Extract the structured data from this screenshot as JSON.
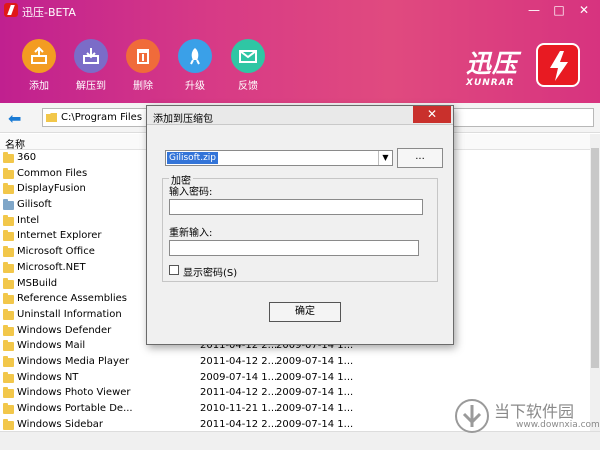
{
  "window": {
    "title": "迅压-BETA",
    "min": "—",
    "max": "□",
    "close": "✕"
  },
  "toolbar": {
    "add": "添加",
    "extract": "解压到",
    "delete": "删除",
    "upgrade": "升级",
    "feedback": "反馈"
  },
  "brand": {
    "cn": "迅压",
    "en": "XUNRAR"
  },
  "address": {
    "path": "C:\\Program Files (x86"
  },
  "list": {
    "header_name": "名称",
    "rows": [
      {
        "name": "360",
        "d1": "",
        "d2": ""
      },
      {
        "name": "Common Files",
        "d1": "",
        "d2": ""
      },
      {
        "name": "DisplayFusion",
        "d1": "",
        "d2": ""
      },
      {
        "name": "Gilisoft",
        "d1": "",
        "d2": ""
      },
      {
        "name": "Intel",
        "d1": "",
        "d2": ""
      },
      {
        "name": "Internet Explorer",
        "d1": "",
        "d2": ""
      },
      {
        "name": "Microsoft Office",
        "d1": "",
        "d2": ""
      },
      {
        "name": "Microsoft.NET",
        "d1": "",
        "d2": ""
      },
      {
        "name": "MSBuild",
        "d1": "",
        "d2": ""
      },
      {
        "name": "Reference Assemblies",
        "d1": "",
        "d2": ""
      },
      {
        "name": "Uninstall Information",
        "d1": "",
        "d2": ""
      },
      {
        "name": "Windows Defender",
        "d1": "",
        "d2": ""
      },
      {
        "name": "Windows Mail",
        "d1": "2011-04-12 2...",
        "d2": "2009-07-14 1..."
      },
      {
        "name": "Windows Media Player",
        "d1": "2011-04-12 2...",
        "d2": "2009-07-14 1..."
      },
      {
        "name": "Windows NT",
        "d1": "2009-07-14 1...",
        "d2": "2009-07-14 1..."
      },
      {
        "name": "Windows Photo Viewer",
        "d1": "2011-04-12 2...",
        "d2": "2009-07-14 1..."
      },
      {
        "name": "Windows Portable De...",
        "d1": "2010-11-21 1...",
        "d2": "2009-07-14 1..."
      },
      {
        "name": "Windows Sidebar",
        "d1": "2011-04-12 2...",
        "d2": "2009-07-14 1..."
      }
    ]
  },
  "dialog": {
    "title": "添加到压缩包",
    "close": "✕",
    "filename": "Gilisoft.zip",
    "browse": "...",
    "group": "加密",
    "password_label": "输入密码:",
    "reenter_label": "重新输入:",
    "show_password": "显示密码(S)",
    "ok": "确定"
  },
  "watermark": {
    "cn": "当下软件园",
    "url": "www.downxia.com"
  },
  "colors": {
    "header_start": "#c0208f",
    "header_end": "#d7337f",
    "brand_red": "#e81a22"
  }
}
